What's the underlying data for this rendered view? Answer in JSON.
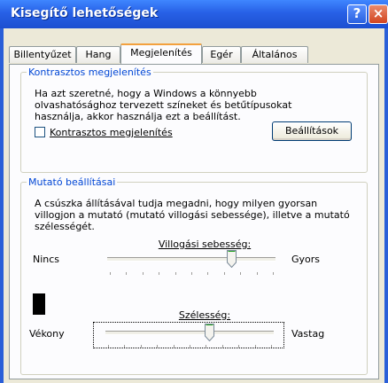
{
  "window": {
    "title": "Kisegítő lehetőségek",
    "help_label": "?",
    "close_label": "×"
  },
  "tabs": [
    {
      "label": "Billentyűzet",
      "active": false
    },
    {
      "label": "Hang",
      "active": false
    },
    {
      "label": "Megjelenítés",
      "active": true
    },
    {
      "label": "Egér",
      "active": false
    },
    {
      "label": "Általános",
      "active": false
    }
  ],
  "contrast": {
    "legend": "Kontrasztos megjelenítés",
    "description_lines": [
      "Ha azt szeretné, hogy a Windows a könnyebb",
      "olvashatósághoz tervezett színeket és betűtípusokat",
      "használja, akkor használja ezt a beállítást."
    ],
    "checkbox_label": "Kontrasztos megjelenítés",
    "checked": false,
    "settings_button": "Beállítások"
  },
  "cursor": {
    "legend": "Mutató beállításai",
    "description_lines": [
      "A csúszka állításával tudja megadni, hogy milyen gyorsan",
      "villogjon a mutató (mutató villogási sebessége), illetve a mutató",
      "szélességét."
    ],
    "blink": {
      "label": "Villogási sebesség:",
      "min_label": "Nincs",
      "max_label": "Gyors",
      "level": 0.74
    },
    "width": {
      "label": "Szélesség:",
      "min_label": "Vékony",
      "max_label": "Vastag",
      "level": 0.62
    }
  },
  "colors": {
    "accent": "#0046d5",
    "tab_highlight": "#f3a13e",
    "background": "#e8a317"
  },
  "icons": {
    "help": "question-mark-icon",
    "close": "close-x-icon"
  }
}
